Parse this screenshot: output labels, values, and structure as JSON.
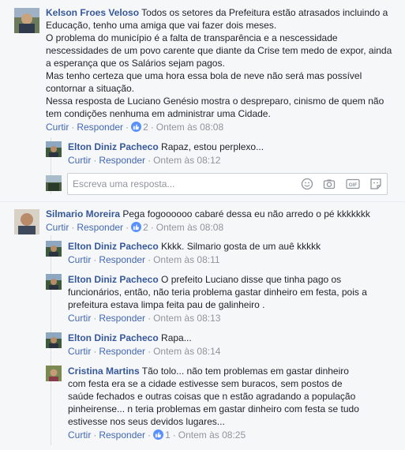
{
  "labels": {
    "like": "Curtir",
    "reply": "Responder",
    "dot": "·",
    "reply_placeholder": "Escreva uma resposta..."
  },
  "comments": [
    {
      "author": "Kelson Froes Veloso",
      "text": " Todos os setores da Prefeitura estão atrasados incluindo a Educação, tenho uma amiga que vai fazer dois meses.\nO problema do município é a falta de transparência e a nescessidade nescessidades de um povo carente que diante da Crise tem medo de expor, ainda a esperança que os Salários sejam pagos.\nMas tenho certeza que uma hora essa bola de neve não será mas possível contornar a situação.\nNessa resposta de Luciano Genésio mostra o despreparo, cinismo de quem não tem condições nenhuma em administrar uma Cidade.",
      "likes": "2",
      "time": "Ontem às 08:08",
      "replies": [
        {
          "author": "Elton Diniz Pacheco",
          "text": " Rapaz, estou perplexo...",
          "time": "Ontem às 08:12"
        }
      ]
    },
    {
      "author": "Silmario Moreira",
      "text": " Pega fogoooooo cabaré dessa eu não arredo o pé kkkkkkk",
      "likes": "2",
      "time": "Ontem às 08:08",
      "replies": [
        {
          "author": "Elton Diniz Pacheco",
          "text": " Kkkk. Silmario gosta de um auê kkkkk",
          "time": "Ontem às 08:11"
        },
        {
          "author": "Elton Diniz Pacheco",
          "text": " O prefeito Luciano disse que tinha pago os funcionários, então, não teria problema gastar dinheiro em festa, pois a prefeitura estava limpa feita pau de galinheiro .",
          "time": "Ontem às 08:13"
        },
        {
          "author": "Elton Diniz Pacheco",
          "text": " Rapa...",
          "time": "Ontem às 08:14"
        },
        {
          "author": "Cristina Martins",
          "text": " Tão tolo... não tem problemas em gastar dinheiro com festa era se a cidade estivesse sem buracos, sem postos de saúde fechados e outras coisas que n estão agradando a população pinheirense... n teria problemas em gastar dinheiro com festa se tudo estivesse nos seus devidos lugares...",
          "likes": "1",
          "time": "Ontem às 08:25"
        }
      ]
    }
  ],
  "icons": {
    "like_badge": "thumbs-up-icon",
    "reply_box": [
      "emoji-icon",
      "camera-icon",
      "gif-icon",
      "sticker-icon"
    ]
  },
  "colors": {
    "background": "#f6f7f9",
    "author": "#365899",
    "link": "#4267b2",
    "meta": "#90949c",
    "like_badge": "#5890ff"
  }
}
